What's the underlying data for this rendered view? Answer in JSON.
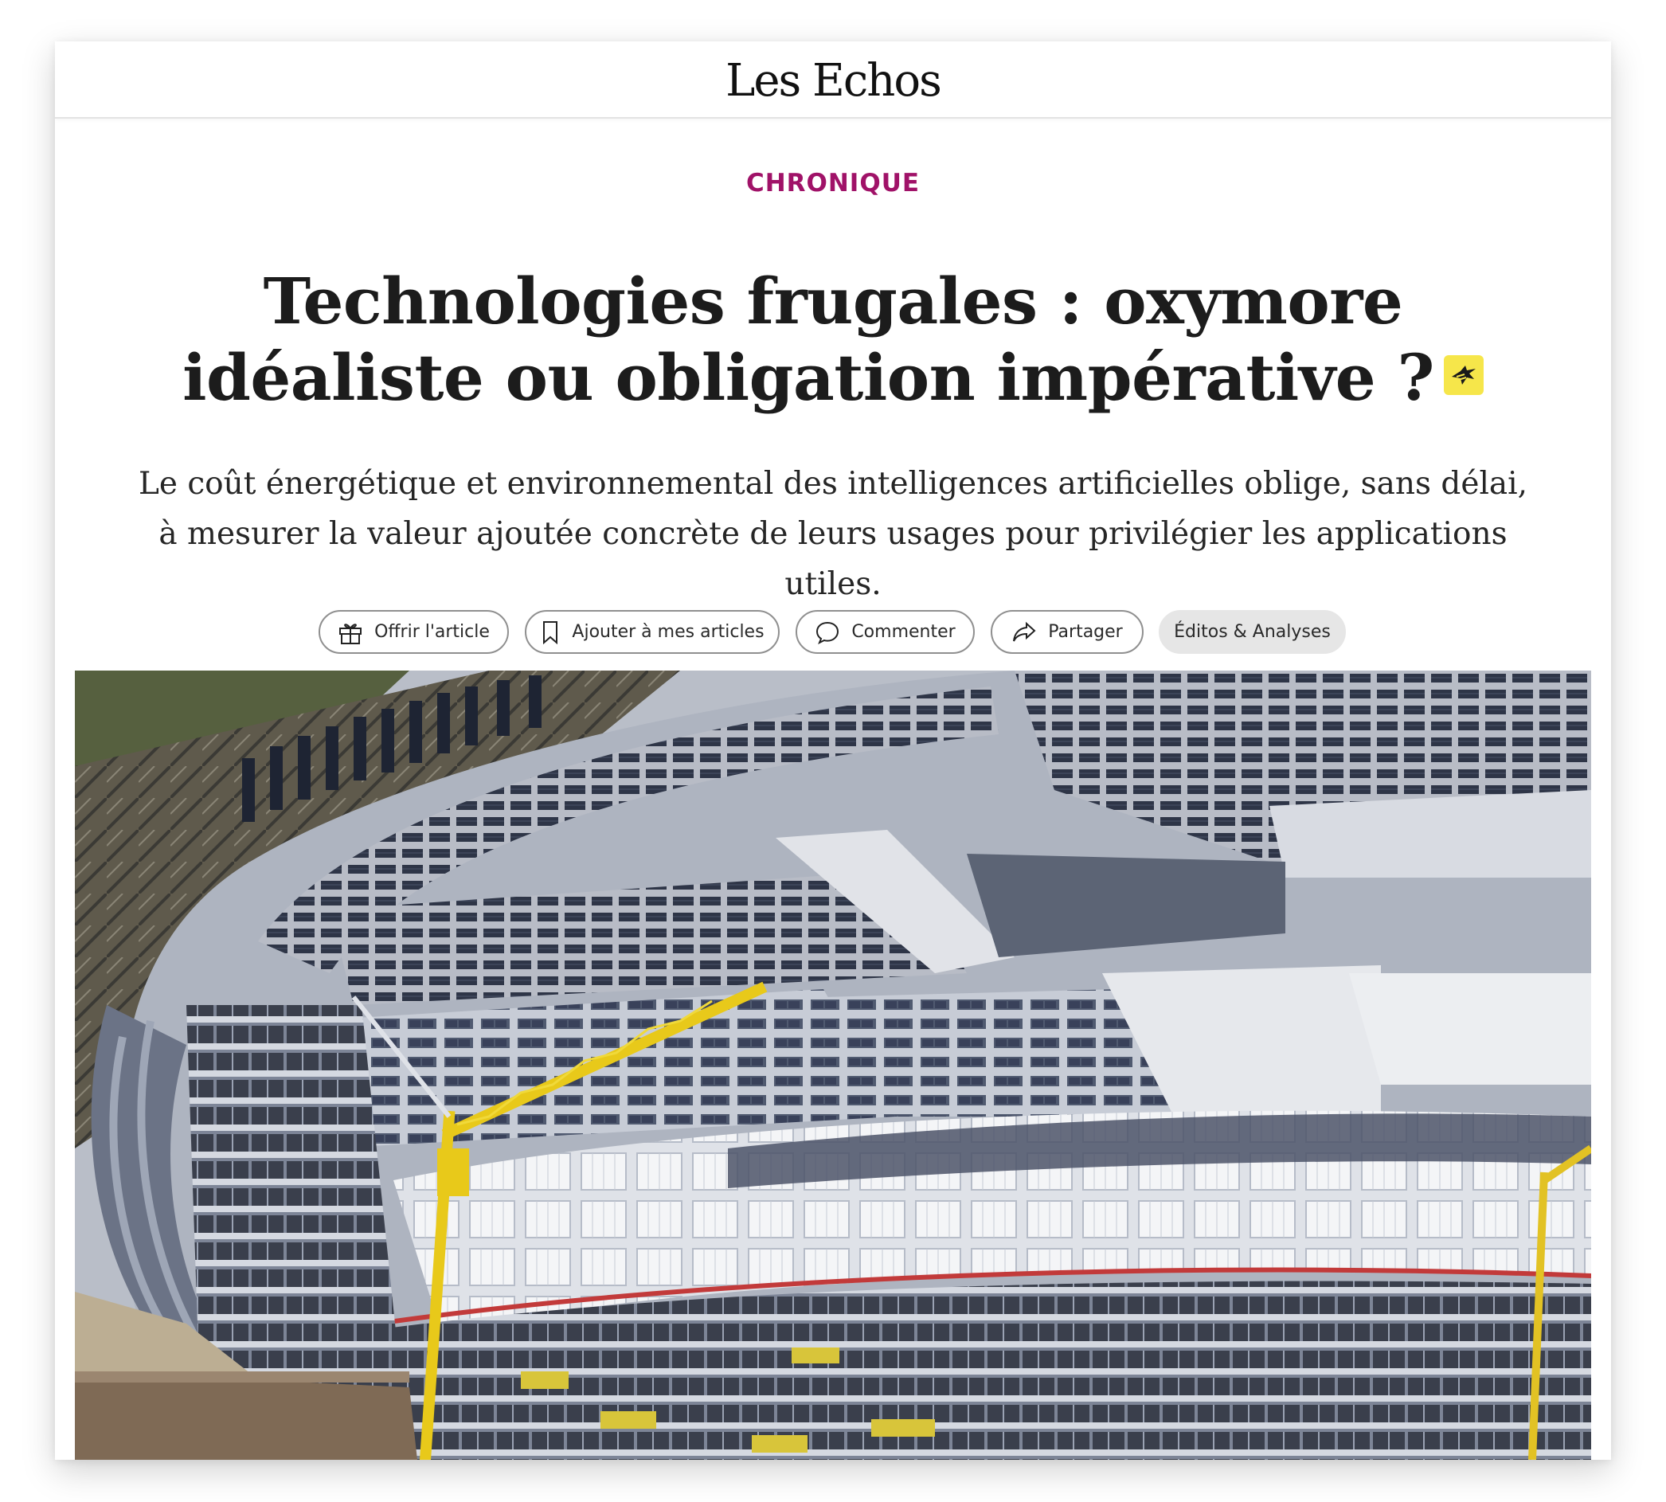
{
  "header": {
    "logo": "Les Echos"
  },
  "article": {
    "kicker": "CHRONIQUE",
    "headline": "Technologies frugales : oxymore idéaliste ou obligation impérative ?",
    "standfirst": "Le coût énergétique et environnemental des intelligences artificielles oblige, sans délai, à mesurer la valeur ajoutée concrète de leurs usages pour privilégier les applications utiles."
  },
  "actions": {
    "offer": "Offrir l'article",
    "save": "Ajouter à mes articles",
    "comment": "Commenter",
    "share": "Partager",
    "section": "Éditos & Analyses"
  },
  "icons": {
    "offer": "gift-icon",
    "save": "bookmark-icon",
    "comment": "comment-bubble-icon",
    "share": "share-arrow-icon",
    "premium": "premium-badge-icon"
  },
  "colors": {
    "kicker": "#a01268",
    "premium_badge": "#f6e64a",
    "section_pill": "#e6e6e6"
  }
}
